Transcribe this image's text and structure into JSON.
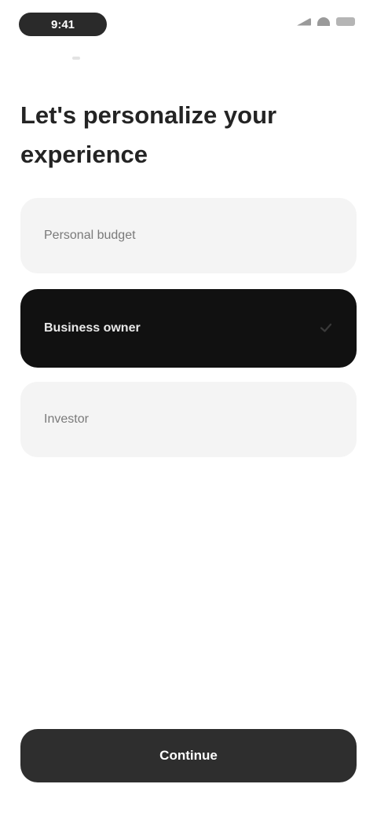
{
  "status_bar": {
    "time": "9:41",
    "icons": [
      "signal-icon",
      "wifi-icon",
      "battery-icon"
    ]
  },
  "header": {
    "back_icon": "chevron-left-icon"
  },
  "page": {
    "title": "Let's personalize your experience"
  },
  "options": [
    {
      "label": "Personal budget",
      "selected": false
    },
    {
      "label": "Business owner",
      "selected": true
    },
    {
      "label": "Investor",
      "selected": false
    }
  ],
  "selected_icon": "check-icon",
  "footer": {
    "continue_label": "Continue"
  },
  "colors": {
    "selected_bg": "#111111",
    "option_bg": "#f4f4f4",
    "button_bg": "#2e2e2e"
  }
}
